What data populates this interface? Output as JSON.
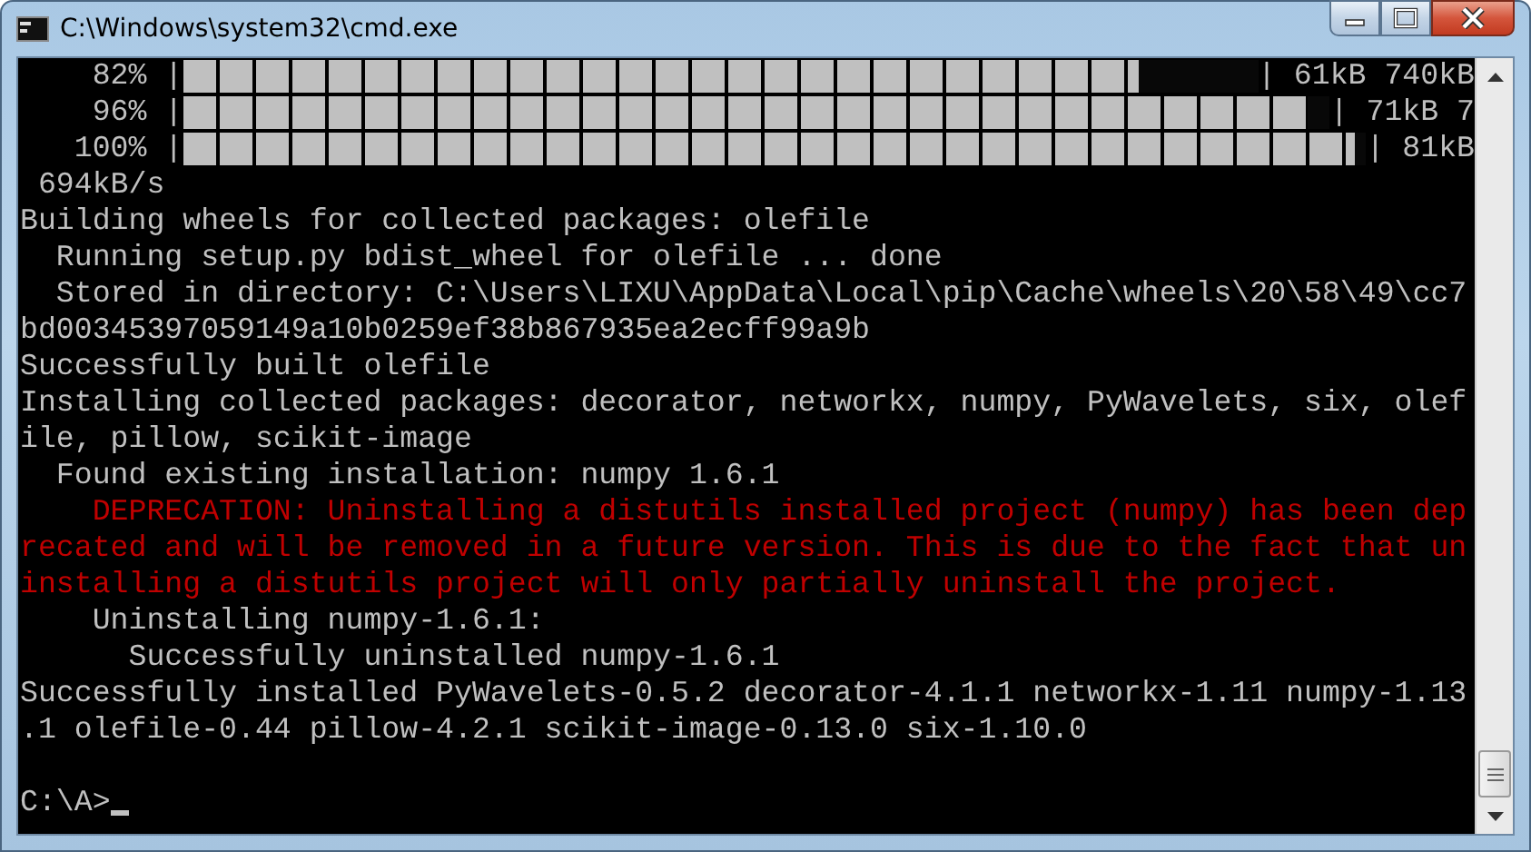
{
  "window": {
    "title": "C:\\Windows\\system32\\cmd.exe"
  },
  "console": {
    "lines": [
      {
        "kind": "progress",
        "percent": "    82% |",
        "level": 0.89,
        "tail": "| 61kB 740kB"
      },
      {
        "kind": "progress",
        "percent": "    96% |",
        "level": 0.98,
        "tail": "| 71kB 7"
      },
      {
        "kind": "progress",
        "percent": "   100% |",
        "level": 0.99,
        "tail": "| 81kB"
      },
      {
        "kind": "output",
        "text": " 694kB/s"
      },
      {
        "kind": "output",
        "text": "Building wheels for collected packages: olefile"
      },
      {
        "kind": "output",
        "text": "  Running setup.py bdist_wheel for olefile ... done"
      },
      {
        "kind": "output",
        "text": "  Stored in directory: C:\\Users\\LIXU\\AppData\\Local\\pip\\Cache\\wheels\\20\\58\\49\\cc7"
      },
      {
        "kind": "output",
        "text": "bd00345397059149a10b0259ef38b867935ea2ecff99a9b"
      },
      {
        "kind": "output",
        "text": "Successfully built olefile"
      },
      {
        "kind": "output",
        "text": "Installing collected packages: decorator, networkx, numpy, PyWavelets, six, olef"
      },
      {
        "kind": "output",
        "text": "ile, pillow, scikit-image"
      },
      {
        "kind": "output",
        "text": "  Found existing installation: numpy 1.6.1"
      },
      {
        "kind": "warning",
        "text": "    DEPRECATION: Uninstalling a distutils installed project (numpy) has been dep"
      },
      {
        "kind": "warning",
        "text": "recated and will be removed in a future version. This is due to the fact that un"
      },
      {
        "kind": "warning",
        "text": "installing a distutils project will only partially uninstall the project."
      },
      {
        "kind": "output",
        "text": "    Uninstalling numpy-1.6.1:"
      },
      {
        "kind": "output",
        "text": "      Successfully uninstalled numpy-1.6.1"
      },
      {
        "kind": "output",
        "text": "Successfully installed PyWavelets-0.5.2 decorator-4.1.1 networkx-1.11 numpy-1.13"
      },
      {
        "kind": "output",
        "text": ".1 olefile-0.44 pillow-4.2.1 scikit-image-0.13.0 six-1.10.0"
      },
      {
        "kind": "prompt",
        "text": "C:\\A>"
      }
    ]
  }
}
